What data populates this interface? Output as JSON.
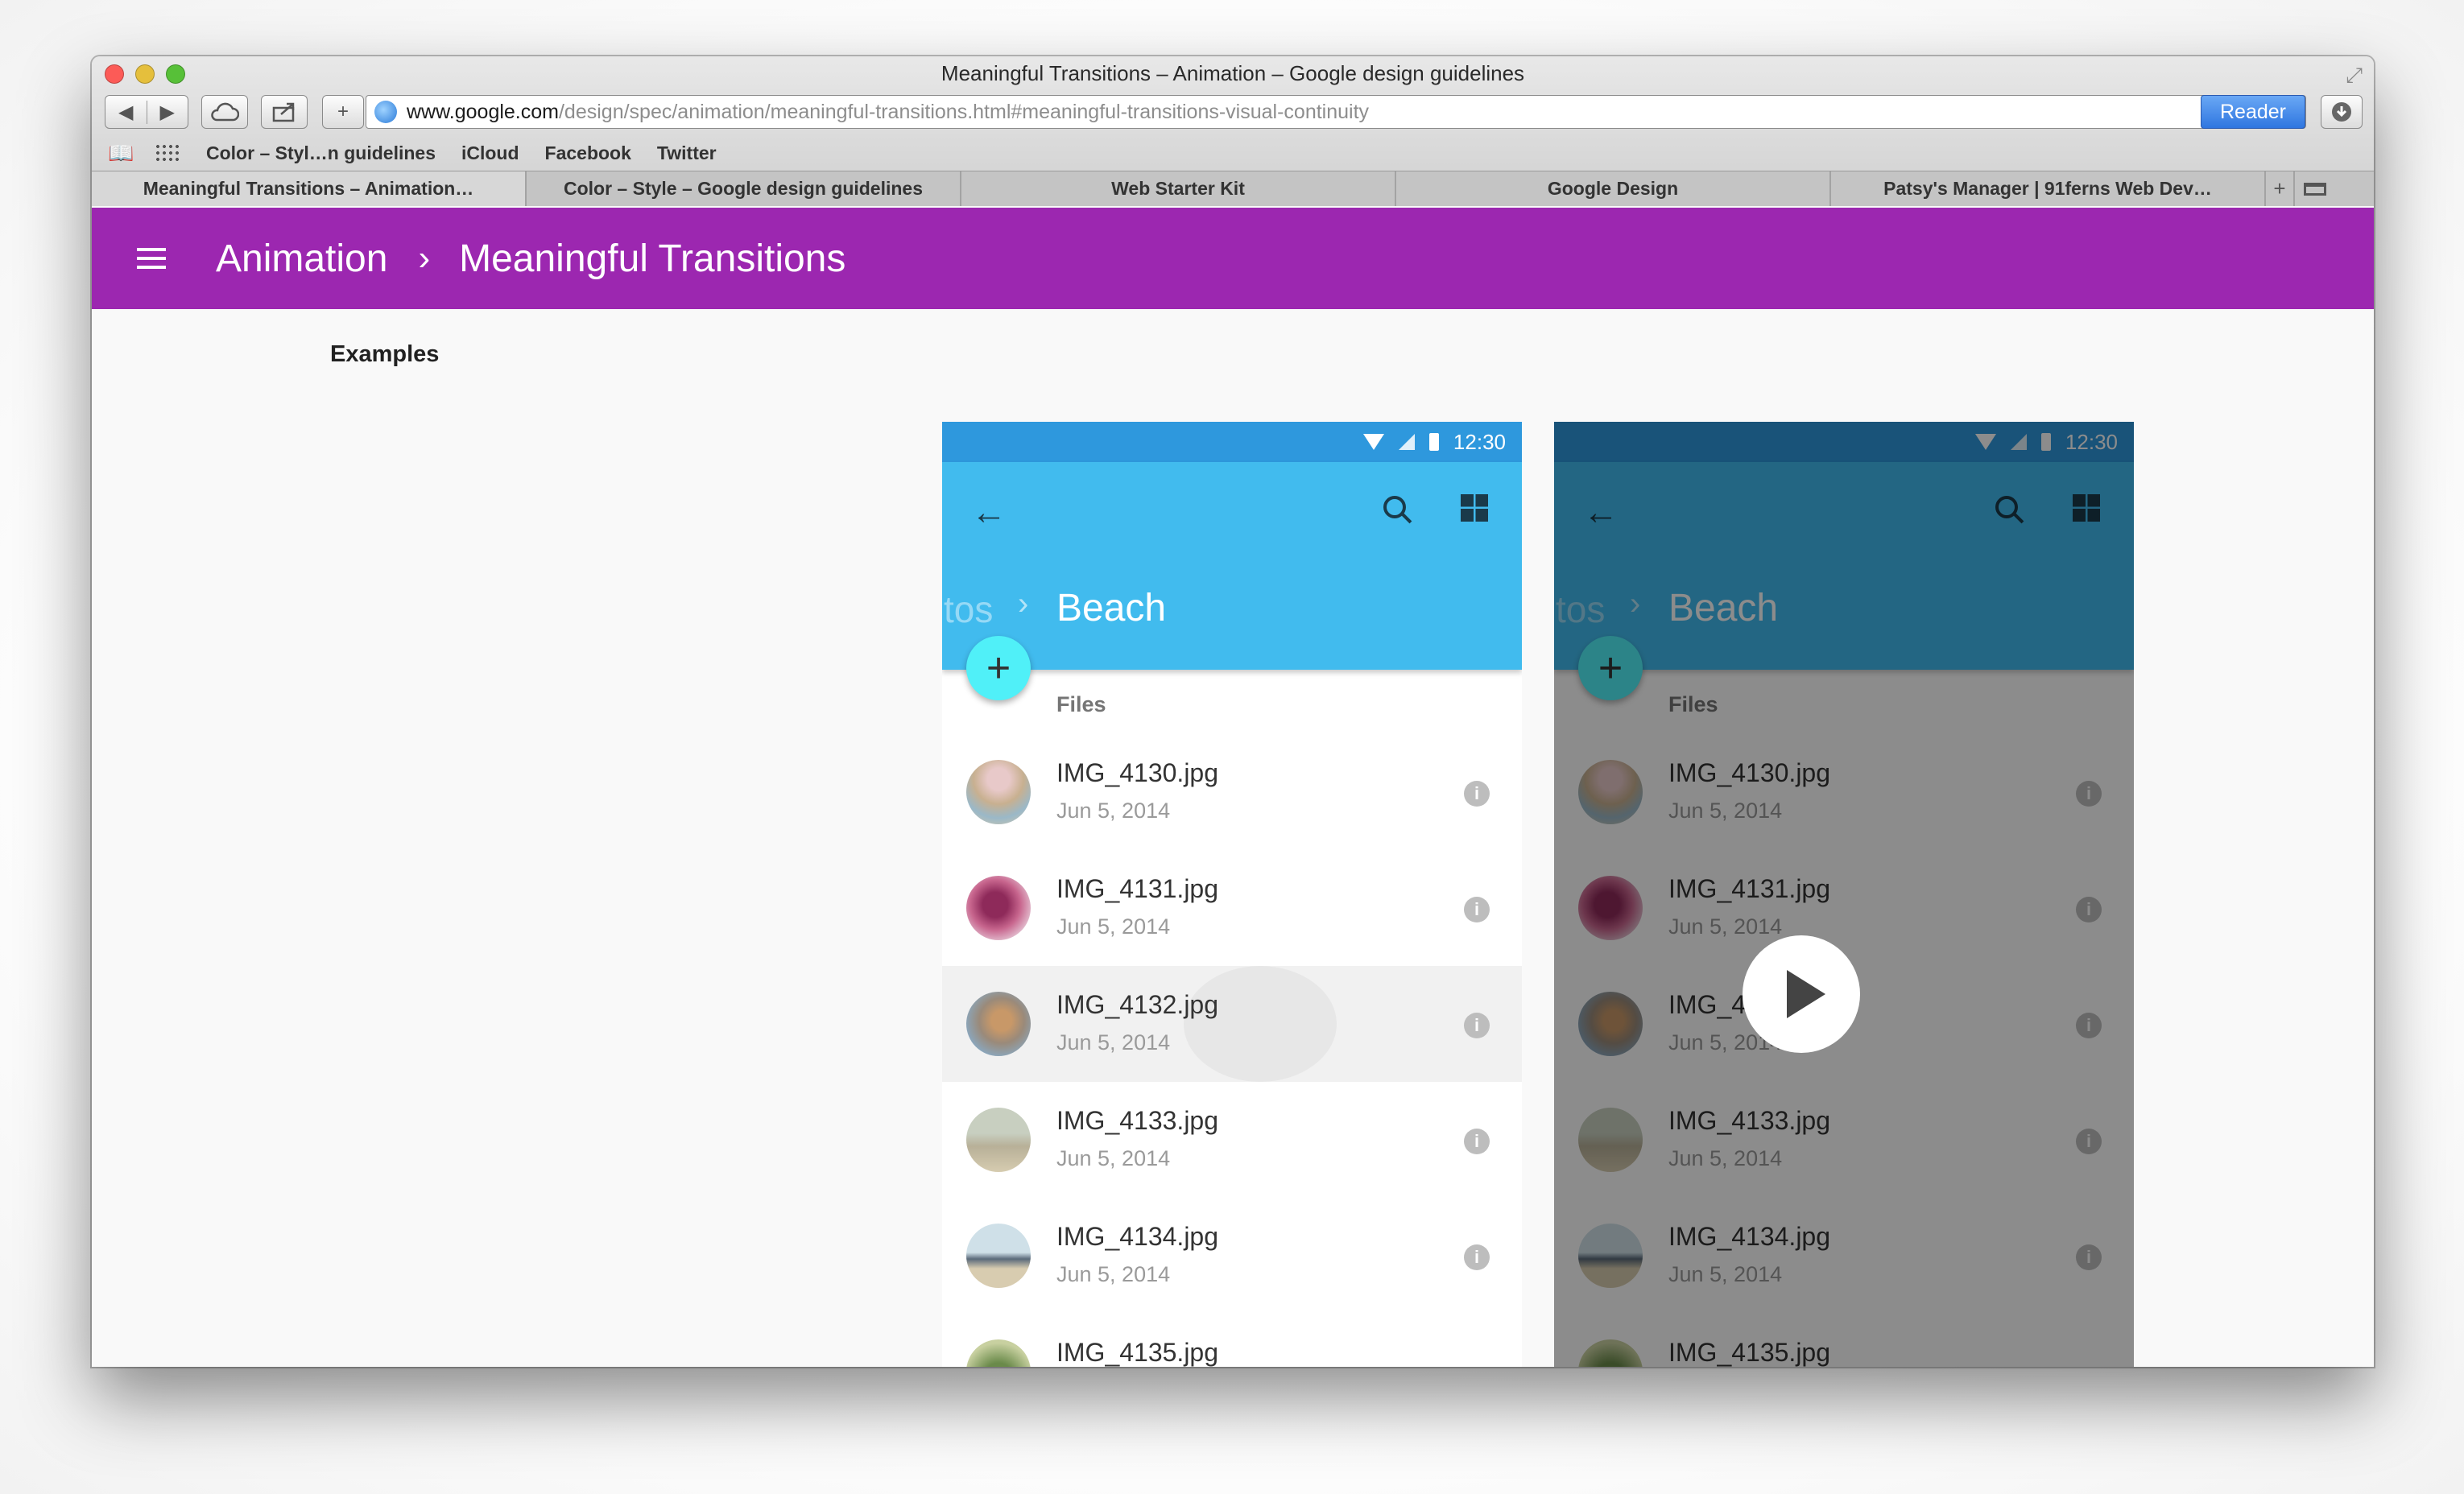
{
  "window": {
    "title": "Meaningful Transitions – Animation – Google design guidelines"
  },
  "toolbar": {
    "url_host": "www.google.com",
    "url_path": "/design/spec/animation/meaningful-transitions.html#meaningful-transitions-visual-continuity",
    "reader_label": "Reader",
    "add_label": "+",
    "reload_label": "↻"
  },
  "bookmarks": [
    "Color – Styl…n guidelines",
    "iCloud",
    "Facebook",
    "Twitter"
  ],
  "tabs": [
    "Meaningful Transitions – Animation…",
    "Color – Style – Google design guidelines",
    "Web Starter Kit",
    "Google Design",
    "Patsy's Manager | 91ferns Web Dev…"
  ],
  "header": {
    "crumb1": "Animation",
    "separator": "›",
    "crumb2": "Meaningful Transitions"
  },
  "section": {
    "title": "Examples"
  },
  "phone": {
    "time": "12:30",
    "crumb_prev": "tos",
    "crumb_arrow": "›",
    "crumb_current": "Beach",
    "fab_label": "+",
    "files_label": "Files",
    "info_glyph": "i",
    "files": [
      {
        "name": "IMG_4130.jpg",
        "date": "Jun 5, 2014"
      },
      {
        "name": "IMG_4131.jpg",
        "date": "Jun 5, 2014"
      },
      {
        "name": "IMG_4132.jpg",
        "date": "Jun 5, 2014"
      },
      {
        "name": "IMG_4133.jpg",
        "date": "Jun 5, 2014"
      },
      {
        "name": "IMG_4134.jpg",
        "date": "Jun 5, 2014"
      },
      {
        "name": "IMG_4135.jpg",
        "date": ""
      }
    ]
  },
  "colors": {
    "header_bg": "#9c27b0",
    "appbar_bg": "#41bbee",
    "statusbar_bg": "#2e98dd",
    "fab_bg": "#50f0f8",
    "reader_bg": "#2f76e0"
  },
  "icons": [
    "back-arrow-icon",
    "search-icon",
    "grid-view-icon",
    "info-icon",
    "play-icon",
    "menu-icon",
    "globe-icon"
  ]
}
